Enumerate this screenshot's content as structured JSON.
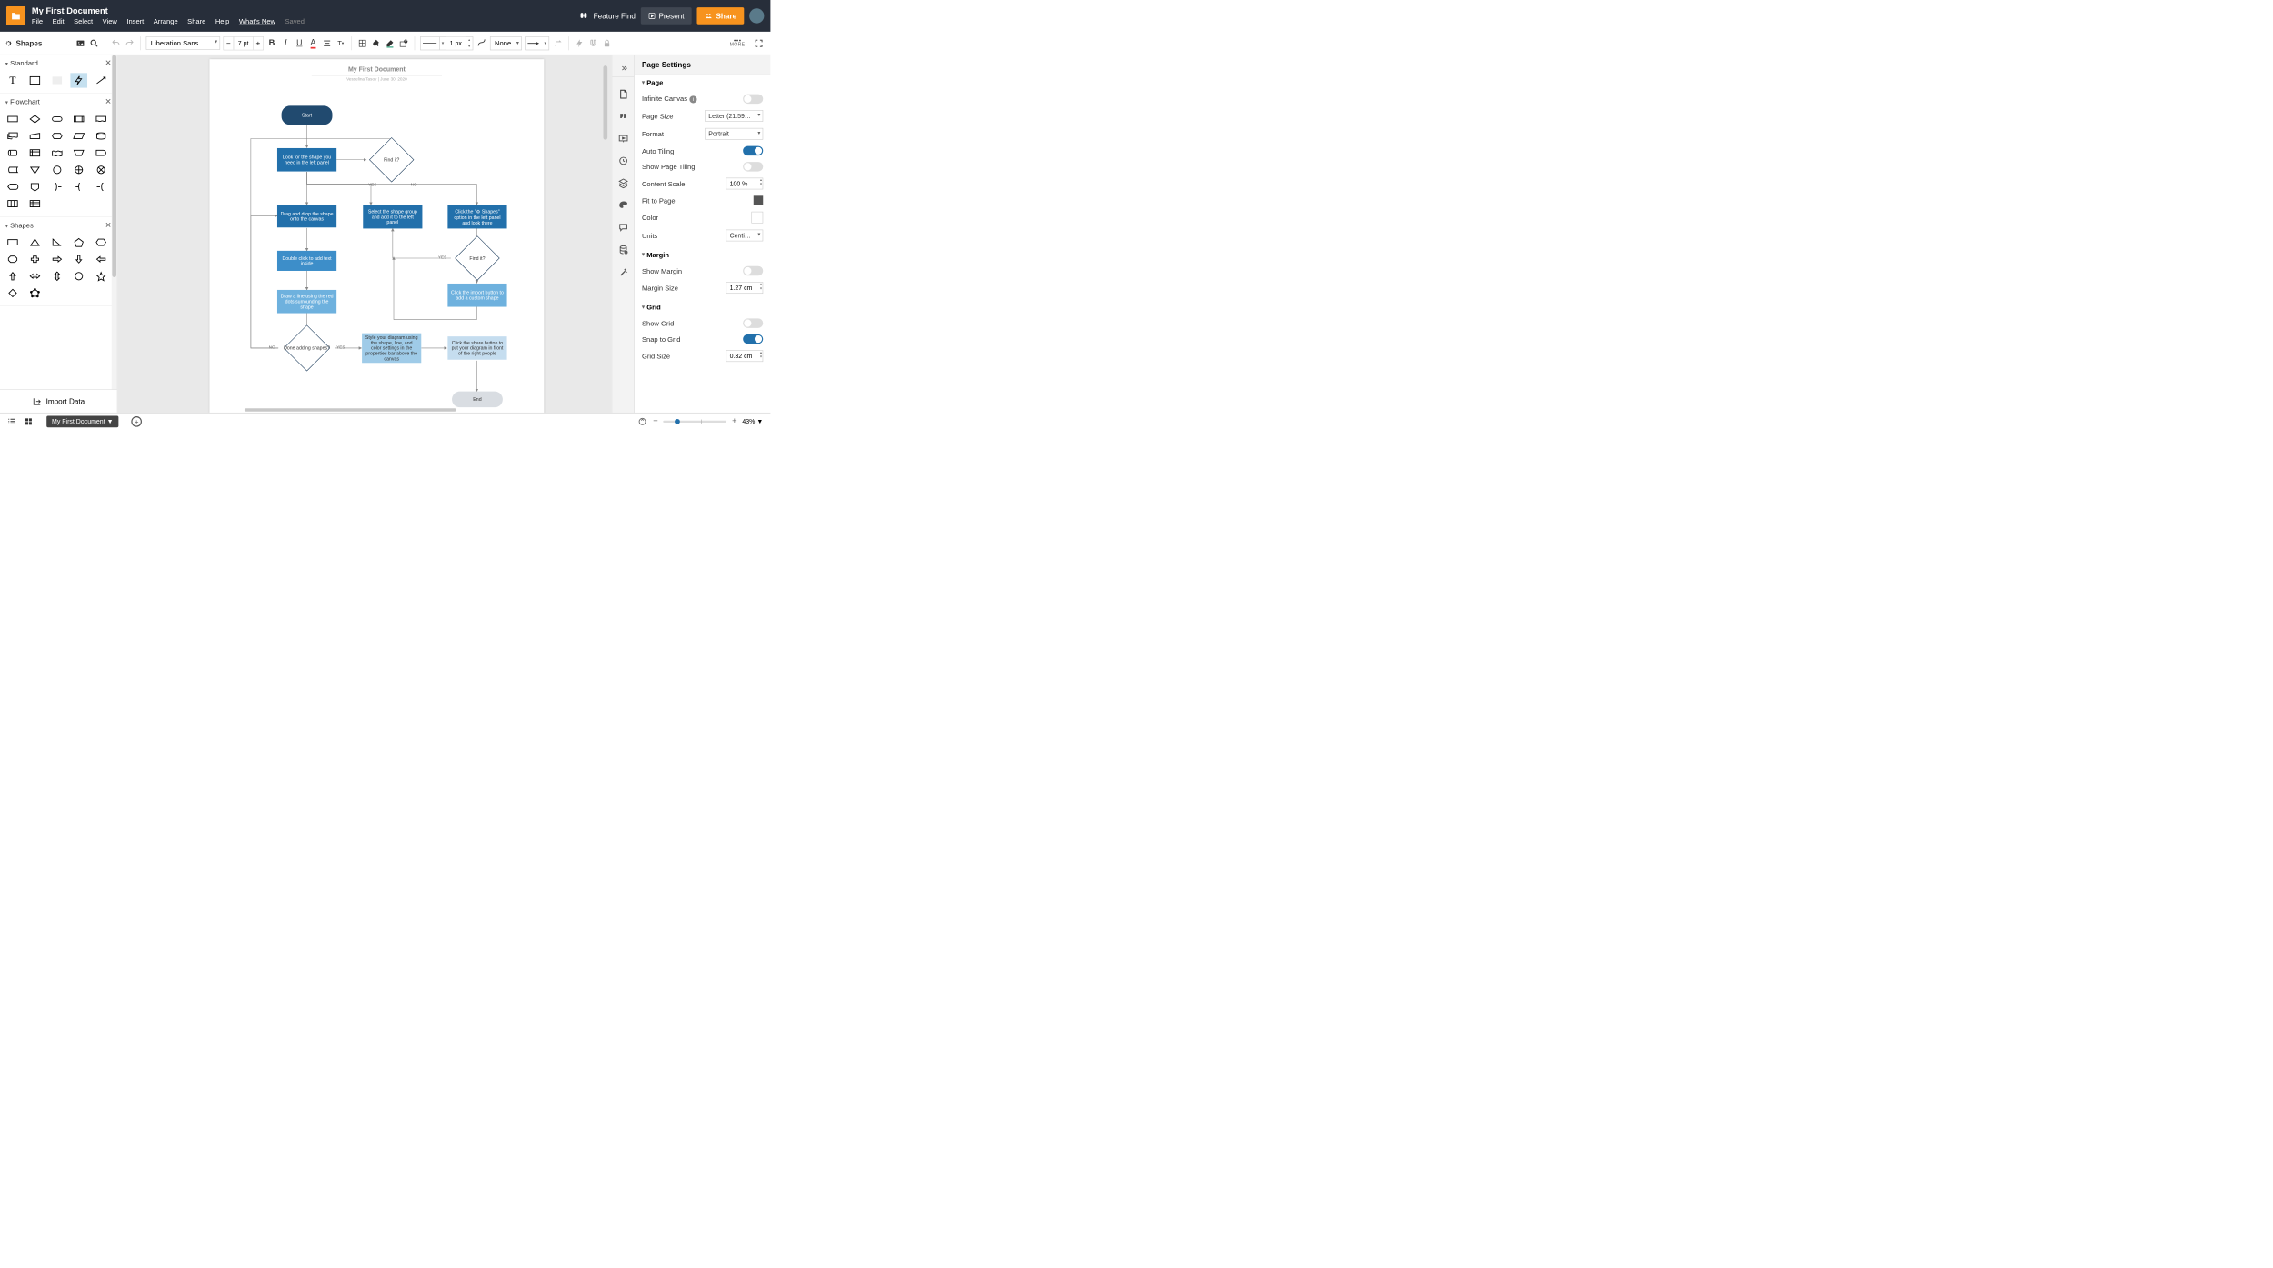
{
  "doc": {
    "title": "My First Document",
    "saved_label": "Saved",
    "author_date": "Vesselina Tasov  |  June 30, 2020"
  },
  "menu": {
    "file": "File",
    "edit": "Edit",
    "select": "Select",
    "view": "View",
    "insert": "Insert",
    "arrange": "Arrange",
    "share": "Share",
    "help": "Help",
    "whatsnew": "What's New"
  },
  "topbar": {
    "feature_find": "Feature Find",
    "present": "Present",
    "share": "Share"
  },
  "toolbar": {
    "shapes": "Shapes",
    "font": "Liberation Sans",
    "font_size": "7 pt",
    "line_weight": "1 px",
    "line_end": "None",
    "more": "MORE"
  },
  "left": {
    "section_standard": "Standard",
    "section_flowchart": "Flowchart",
    "section_shapes": "Shapes",
    "import_data": "Import Data"
  },
  "flowchart": {
    "title": "My First Document",
    "start": "Start",
    "look_shape": "Look for the shape you need in the left panel",
    "find_it": "Find it?",
    "yes": "YES",
    "no": "NO",
    "drag_drop": "Drag and drop the shape onto the canvas",
    "select_group": "Select the shape group and add it to the left panel",
    "click_shapes": "Click the \"⚙ Shapes\" option in the left panel and look there",
    "double_click": "Double click to add text inside",
    "find_it2": "Find it?",
    "draw_line": "Draw a line using the red dots surrounding the shape",
    "click_import": "Click the import button to add a custom shape",
    "done_adding": "Done adding shapes?",
    "style_diagram": "Style your diagram using the shape, line, and color settings in the properties bar above the canvas",
    "click_share": "Click the share button to put your diagram in front of the right people",
    "end": "End"
  },
  "right": {
    "header": "Page Settings",
    "page": "Page",
    "infinite_canvas": "Infinite Canvas",
    "page_size": "Page Size",
    "page_size_value": "Letter (21.59…",
    "format": "Format",
    "format_value": "Portrait",
    "auto_tiling": "Auto Tiling",
    "show_tiling": "Show Page Tiling",
    "content_scale": "Content Scale",
    "content_scale_value": "100 %",
    "fit_to_page": "Fit to Page",
    "color": "Color",
    "units": "Units",
    "units_value": "Centi…",
    "margin": "Margin",
    "show_margin": "Show Margin",
    "margin_size": "Margin Size",
    "margin_size_value": "1.27 cm",
    "grid": "Grid",
    "show_grid": "Show Grid",
    "snap_grid": "Snap to Grid",
    "grid_size": "Grid Size",
    "grid_size_value": "0.32 cm"
  },
  "bottom": {
    "page_tab": "My First Document ▼",
    "zoom_pct": "43% ▼"
  }
}
